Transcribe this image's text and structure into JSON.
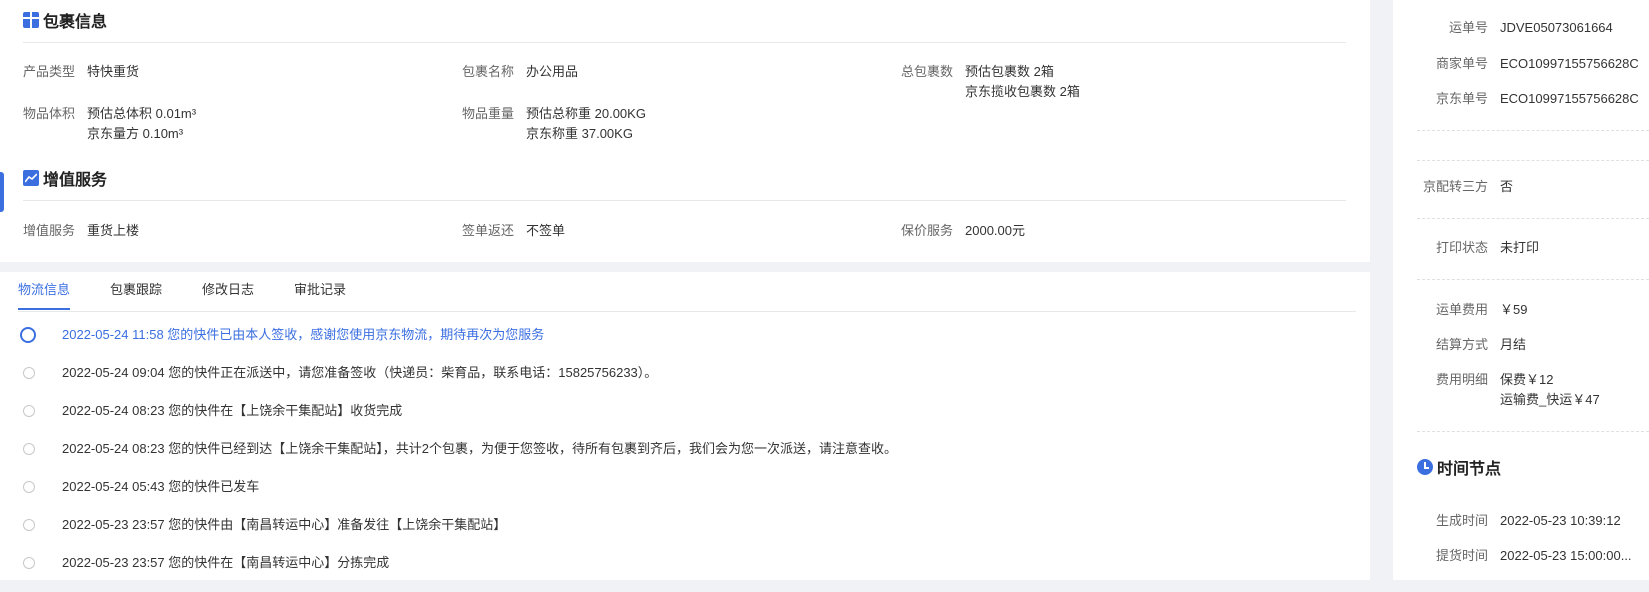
{
  "package_info": {
    "title": "包裹信息",
    "product_type": {
      "label": "产品类型",
      "value": "特快重货"
    },
    "package_name": {
      "label": "包裹名称",
      "value": "办公用品"
    },
    "total_packages": {
      "label": "总包裹数",
      "line1": "预估包裹数 2箱",
      "line2": "京东揽收包裹数 2箱"
    },
    "volume": {
      "label": "物品体积",
      "line1": "预估总体积 0.01m³",
      "line2": "京东量方 0.10m³"
    },
    "weight": {
      "label": "物品重量",
      "line1": "预估总称重 20.00KG",
      "line2": "京东称重 37.00KG"
    }
  },
  "value_added": {
    "title": "增值服务",
    "service": {
      "label": "增值服务",
      "value": "重货上楼"
    },
    "receipt_return": {
      "label": "签单返还",
      "value": "不签单"
    },
    "insurance": {
      "label": "保价服务",
      "value": "2000.00元"
    }
  },
  "tabs": [
    {
      "label": "物流信息",
      "active": true
    },
    {
      "label": "包裹跟踪",
      "active": false
    },
    {
      "label": "修改日志",
      "active": false
    },
    {
      "label": "审批记录",
      "active": false
    }
  ],
  "timeline": [
    "2022-05-24 11:58 您的快件已由本人签收，感谢您使用京东物流，期待再次为您服务",
    "2022-05-24 09:04 您的快件正在派送中，请您准备签收（快递员：柴育品，联系电话：15825756233）。",
    "2022-05-24 08:23 您的快件在【上饶余干集配站】收货完成",
    "2022-05-24 08:23 您的快件已经到达【上饶余干集配站】，共计2个包裹，为便于您签收，待所有包裹到齐后，我们会为您一次派送，请注意查收。",
    "2022-05-24 05:43 您的快件已发车",
    "2022-05-23 23:57 您的快件由【南昌转运中心】准备发往【上饶余干集配站】",
    "2022-05-23 23:57 您的快件在【南昌转运中心】分拣完成"
  ],
  "right": {
    "waybill": {
      "label": "运单号",
      "value": "JDVE05073061664"
    },
    "merchant_no": {
      "label": "商家单号",
      "value": "ECO10997155756628C"
    },
    "jd_no": {
      "label": "京东单号",
      "value": "ECO10997155756628C"
    },
    "third_party": {
      "label": "京配转三方",
      "value": "否"
    },
    "print_status": {
      "label": "打印状态",
      "value": "未打印"
    },
    "freight": {
      "label": "运单费用",
      "value": "￥59"
    },
    "settlement": {
      "label": "结算方式",
      "value": "月结"
    },
    "fee_detail": {
      "label": "费用明细",
      "line1": "保费￥12",
      "line2": "运输费_快运￥47"
    },
    "time_title": "时间节点",
    "created": {
      "label": "生成时间",
      "value": "2022-05-23 10:39:12"
    },
    "pickup": {
      "label": "提货时间",
      "value": "2022-05-23 15:00:00..."
    }
  },
  "colors": {
    "accent": "#3b6fe0"
  }
}
